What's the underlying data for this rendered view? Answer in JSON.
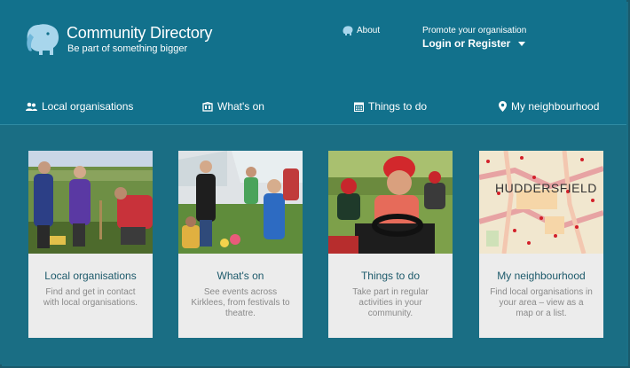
{
  "header": {
    "title": "Community Directory",
    "tagline": "Be part of something bigger",
    "about_label": "About",
    "promote_label": "Promote your organisation",
    "login_label": "Login or Register"
  },
  "nav": {
    "items": [
      {
        "label": "Local organisations",
        "icon": "people-icon"
      },
      {
        "label": "What's on",
        "icon": "theatre-icon"
      },
      {
        "label": "Things to do",
        "icon": "calendar-icon"
      },
      {
        "label": "My neighbourhood",
        "icon": "map-pin-icon"
      }
    ]
  },
  "cards": [
    {
      "title": "Local organisations",
      "description": "Find and get in contact with local organisations.",
      "image": "gardening-volunteers-photo"
    },
    {
      "title": "What's on",
      "description": "See events across Kirklees, from festivals to theatre.",
      "image": "outdoor-festival-photo"
    },
    {
      "title": "Things to do",
      "description": "Take part in regular activities in your community.",
      "image": "go-kart-activity-photo"
    },
    {
      "title": "My neighbourhood",
      "description": "Find local organisations in your area – view as a map or a list.",
      "image": "huddersfield-map-image",
      "map_label": "HUDDERSFIELD"
    }
  ],
  "colors": {
    "header_bg": "#12718c",
    "body_bg": "#1a6e84",
    "card_bg": "#ececec",
    "card_title": "#1d5a6b",
    "card_text": "#8a8a8a"
  }
}
